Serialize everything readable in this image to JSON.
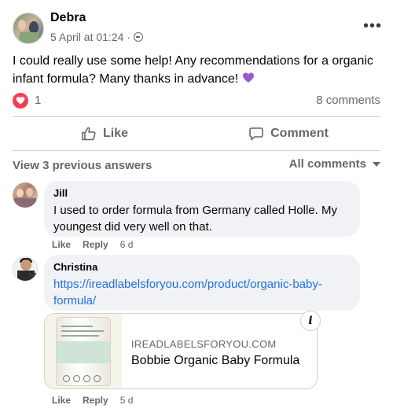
{
  "post": {
    "author": "Debra",
    "timestamp": "5 April at 01:24",
    "privacy_icon": "globe-icon",
    "more_label": "•••",
    "text": "I could really use some help! Any recommendations for a organic infant formula? Many thanks in advance!",
    "text_emoji": "purple-heart",
    "reaction_icon": "love-reaction-icon",
    "reaction_count": "1",
    "comment_count": "8 comments"
  },
  "actions": {
    "like_label": "Like",
    "comment_label": "Comment"
  },
  "comments_header": {
    "view_previous": "View 3 previous answers",
    "filter_label": "All comments"
  },
  "comments": [
    {
      "author": "Jill",
      "text": "I used to order formula from Germany called Holle. My youngest did very well on that.",
      "like_label": "Like",
      "reply_label": "Reply",
      "age": "6 d"
    },
    {
      "author": "Christina",
      "link": "https://ireadlabelsforyou.com/product/organic-baby-formula/",
      "like_label": "Like",
      "reply_label": "Reply",
      "age": "5 d",
      "preview": {
        "domain": "IREADLABELSFORYOU.COM",
        "title": "Bobbie Organic Baby Formula",
        "info_label": "i"
      }
    }
  ],
  "colors": {
    "link": "#216fdb",
    "secondary_text": "#65676b",
    "love_reaction": "#f33e58",
    "bubble_bg": "#f0f2f5",
    "emoji_purple": "#9b59d0"
  }
}
